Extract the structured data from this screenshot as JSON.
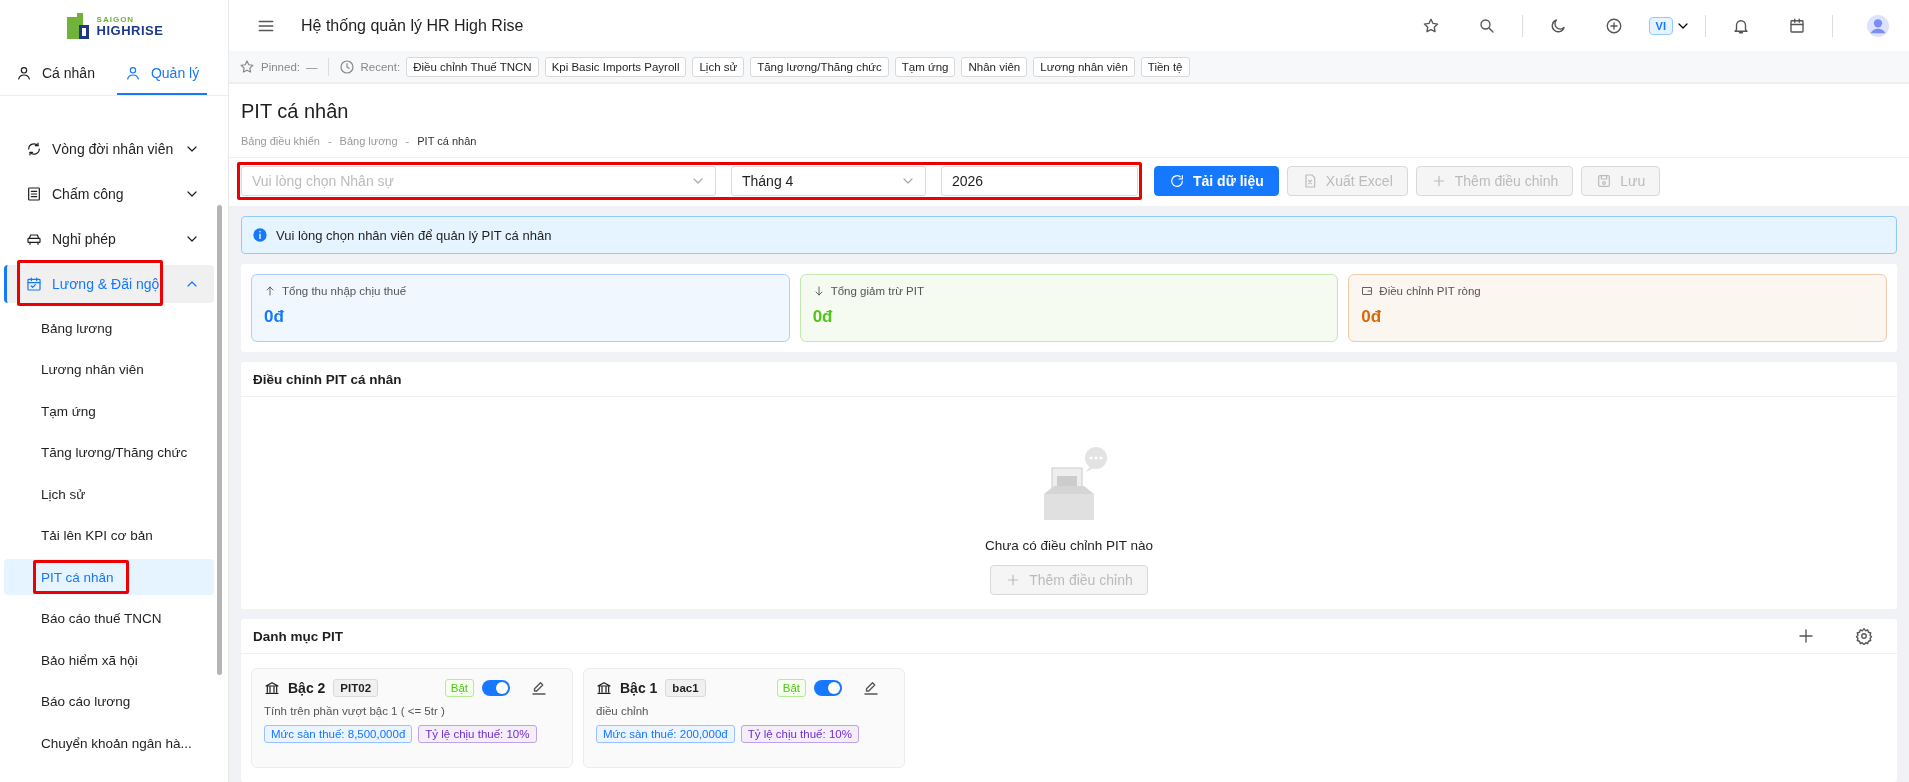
{
  "logo": {
    "line1": "SAIGON",
    "line2": "HIGHRISE"
  },
  "sidebar": {
    "tabs": [
      {
        "label": "Cá nhân",
        "selected": false
      },
      {
        "label": "Quản lý",
        "selected": true
      }
    ],
    "items": [
      {
        "label": "Vòng đời nhân viên",
        "expanded": false,
        "highlighted": false
      },
      {
        "label": "Chấm công",
        "expanded": false,
        "highlighted": false
      },
      {
        "label": "Nghỉ phép",
        "expanded": false,
        "highlighted": false
      },
      {
        "label": "Lương & Đãi ngộ",
        "expanded": true,
        "highlighted": true,
        "children": [
          {
            "label": "Bảng lương",
            "selected": false,
            "highlighted": false
          },
          {
            "label": "Lương nhân viên",
            "selected": false,
            "highlighted": false
          },
          {
            "label": "Tạm ứng",
            "selected": false,
            "highlighted": false
          },
          {
            "label": "Tăng lương/Thăng chức",
            "selected": false,
            "highlighted": false
          },
          {
            "label": "Lịch sử",
            "selected": false,
            "highlighted": false
          },
          {
            "label": "Tải lên KPI cơ bản",
            "selected": false,
            "highlighted": false
          },
          {
            "label": "PIT cá nhân",
            "selected": true,
            "highlighted": true
          },
          {
            "label": "Báo cáo thuế TNCN",
            "selected": false,
            "highlighted": false
          },
          {
            "label": "Bảo hiểm xã hội",
            "selected": false,
            "highlighted": false
          },
          {
            "label": "Báo cáo lương",
            "selected": false,
            "highlighted": false
          },
          {
            "label": "Chuyển khoản ngân hà...",
            "selected": false,
            "highlighted": false
          }
        ]
      }
    ]
  },
  "header": {
    "title": "Hệ thống quản lý HR High Rise",
    "language": "VI"
  },
  "quick_bar": {
    "pinned_label": "Pinned:",
    "pinned_value": "—",
    "recent_label": "Recent:",
    "recent": [
      "Điều chỉnh Thuế TNCN",
      "Kpi Basic Imports Payroll",
      "Lịch sử",
      "Tăng lương/Thăng chức",
      "Tạm ứng",
      "Nhân viên",
      "Lương nhân viên",
      "Tiền tệ"
    ]
  },
  "page": {
    "title": "PIT cá nhân",
    "breadcrumb_separator": "-",
    "breadcrumbs": [
      "Bảng điều khiển",
      "Bảng lương",
      "PIT cá nhân"
    ]
  },
  "filters": {
    "highlighted": true,
    "employee": {
      "placeholder": "Vui lòng chọn Nhân sự"
    },
    "month": {
      "value": "Tháng 4"
    },
    "year": {
      "value": "2026"
    }
  },
  "actions": [
    {
      "label": "Tải dữ liệu",
      "kind": "primary",
      "disabled": false
    },
    {
      "label": "Xuất Excel",
      "kind": "excel",
      "disabled": true
    },
    {
      "label": "Thêm điều chỉnh",
      "kind": "add",
      "disabled": true
    },
    {
      "label": "Lưu",
      "kind": "save",
      "disabled": true
    }
  ],
  "alert": {
    "text": "Vui lòng chọn nhân viên để quản lý PIT cá nhân"
  },
  "stats": [
    {
      "label": "Tổng thu nhập chịu thuế",
      "value": "0đ",
      "color": "#1677ff"
    },
    {
      "label": "Tổng giảm trừ PIT",
      "value": "0đ",
      "color": "#52c41a"
    },
    {
      "label": "Điều chỉnh PIT ròng",
      "value": "0đ",
      "color": "#d46b08"
    }
  ],
  "adjustments": {
    "title": "Điều chỉnh PIT cá nhân",
    "empty_text": "Chưa có điều chỉnh PIT nào",
    "add_button": {
      "label": "Thêm điều chỉnh",
      "disabled": true
    }
  },
  "catalog": {
    "title": "Danh mục PIT",
    "cards": [
      {
        "name": "Bậc 2",
        "code": "PIT02",
        "status": "Bật",
        "on": true,
        "description": "Tính trên phần vượt bậc 1 ( <= 5tr )",
        "tags": [
          {
            "text": "Mức sàn thuế: 8,500,000đ",
            "color": "#1677ff"
          },
          {
            "text": "Tỷ lệ chịu thuế: 10%",
            "color": "#722ed1"
          }
        ]
      },
      {
        "name": "Bậc 1",
        "code": "bac1",
        "status": "Bật",
        "on": true,
        "description": "điều chỉnh",
        "tags": [
          {
            "text": "Mức sàn thuế: 200,000đ",
            "color": "#1677ff"
          },
          {
            "text": "Tỷ lệ chịu thuế: 10%",
            "color": "#722ed1"
          }
        ]
      }
    ]
  }
}
